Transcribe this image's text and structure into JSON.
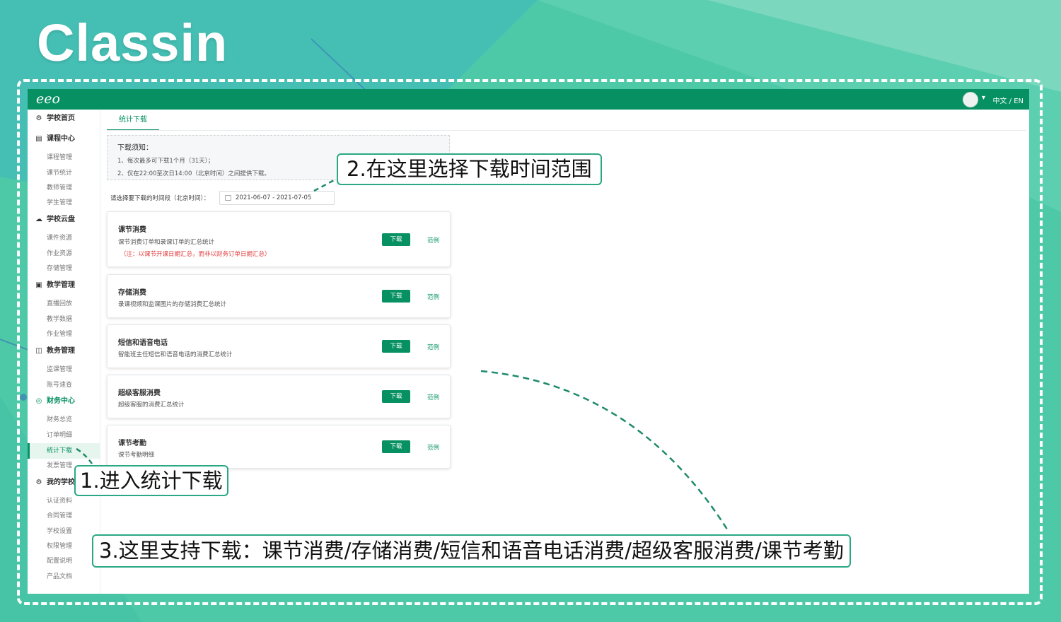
{
  "brand": "Classin",
  "app": {
    "logo": "eeo",
    "lang": "中文 / EN"
  },
  "sidebar": {
    "groups": [
      {
        "icon": "settings-gear-icon",
        "glyph": "⚙",
        "label": "学校首页",
        "items": []
      },
      {
        "icon": "calendar-icon",
        "glyph": "▤",
        "label": "课程中心",
        "items": [
          "课程管理",
          "课节统计",
          "教师管理",
          "学生管理"
        ]
      },
      {
        "icon": "cloud-icon",
        "glyph": "☁",
        "label": "学校云盘",
        "items": [
          "课件资源",
          "作业资源",
          "存储管理"
        ]
      },
      {
        "icon": "board-icon",
        "glyph": "▣",
        "label": "教学管理",
        "items": [
          "直播回放",
          "教学数据",
          "作业管理"
        ]
      },
      {
        "icon": "grid-icon",
        "glyph": "◫",
        "label": "教务管理",
        "items": [
          "监课管理",
          "账号速查"
        ]
      },
      {
        "icon": "finance-icon",
        "glyph": "◎",
        "label": "财务中心",
        "items": [
          "财务总览",
          "订单明细",
          "统计下载",
          "发票管理"
        ]
      },
      {
        "icon": "school-icon",
        "glyph": "⚙",
        "label": "我的学校",
        "items": [
          "认证资料",
          "合同管理",
          "学校设置",
          "权限管理",
          "配置说明",
          "产品文档"
        ]
      }
    ],
    "active_item": "统计下载"
  },
  "main": {
    "tab": "统计下载",
    "notice": {
      "title": "下载须知：",
      "line1": "1、每次最多可下载1个月（31天）；",
      "line2": "2、仅在22:00至次日14:00（北京时间）之间提供下载。"
    },
    "range_label": "请选择要下载的时间段（北京时间）：",
    "date_range": "2021-06-07   - 2021-07-05",
    "download_label": "下载",
    "example_label": "范例",
    "cards": [
      {
        "title": "课节消费",
        "desc": "课节消费订单和录课订单的汇总统计",
        "note": "（注：以课节开课日期汇总，而非以财务订单日期汇总）"
      },
      {
        "title": "存储消费",
        "desc": "录课视频和监课图片的存储消费汇总统计"
      },
      {
        "title": "短信和语音电话",
        "desc": "智能班主任短信和语音电话的消费汇总统计"
      },
      {
        "title": "超级客服消费",
        "desc": "超级客服的消费汇总统计"
      },
      {
        "title": "课节考勤",
        "desc": "课节考勤明细"
      }
    ]
  },
  "callouts": {
    "step1": "1.进入统计下载",
    "step2": "2.在这里选择下载时间范围",
    "step3": "3.这里支持下载：课节消费/存储消费/短信和语音电话消费/超级客服消费/课节考勤"
  },
  "colors": {
    "brand_green": "#079162",
    "background": "#4ec9a8",
    "note_red": "#e23c3c"
  }
}
